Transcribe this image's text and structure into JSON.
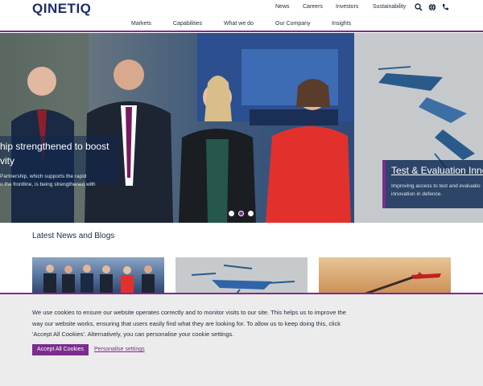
{
  "header": {
    "logo": "QINETIQ",
    "utility_links": [
      "News",
      "Careers",
      "Investors",
      "Sustainability"
    ],
    "icons": [
      "search-icon",
      "globe-icon",
      "phone-icon"
    ]
  },
  "nav": {
    "items": [
      "Markets",
      "Capabilities",
      "What we do",
      "Our Company",
      "Insights"
    ]
  },
  "hero": {
    "left_title_line1": "hip strengthened to boost",
    "left_title_line2": "vity",
    "left_desc_line1": "Partnership, which supports the rapid",
    "left_desc_line2": "o the frontline, is being strengthened with",
    "right_title": "Test & Evaluation Inno",
    "right_desc_line1": "Improving access to test and evaluatio",
    "right_desc_line2": "innovation in defence.",
    "dots_active_index": 1
  },
  "news": {
    "heading": "Latest News and Blogs"
  },
  "cookie": {
    "text": "We use cookies to ensure our website operates correctly and to monitor visits to our site. This helps us to improve the way our website works, ensuring that users easily find what they are looking for. To allow us to keep doing this, click 'Accept All Cookies'. Alternatively, you can personalise your cookie settings.",
    "accept_label": "Accept All Cookies",
    "personalise_label": "Personalise settings"
  },
  "colors": {
    "brand_purple": "#7b2d8e",
    "brand_navy": "#1c2b6b"
  }
}
